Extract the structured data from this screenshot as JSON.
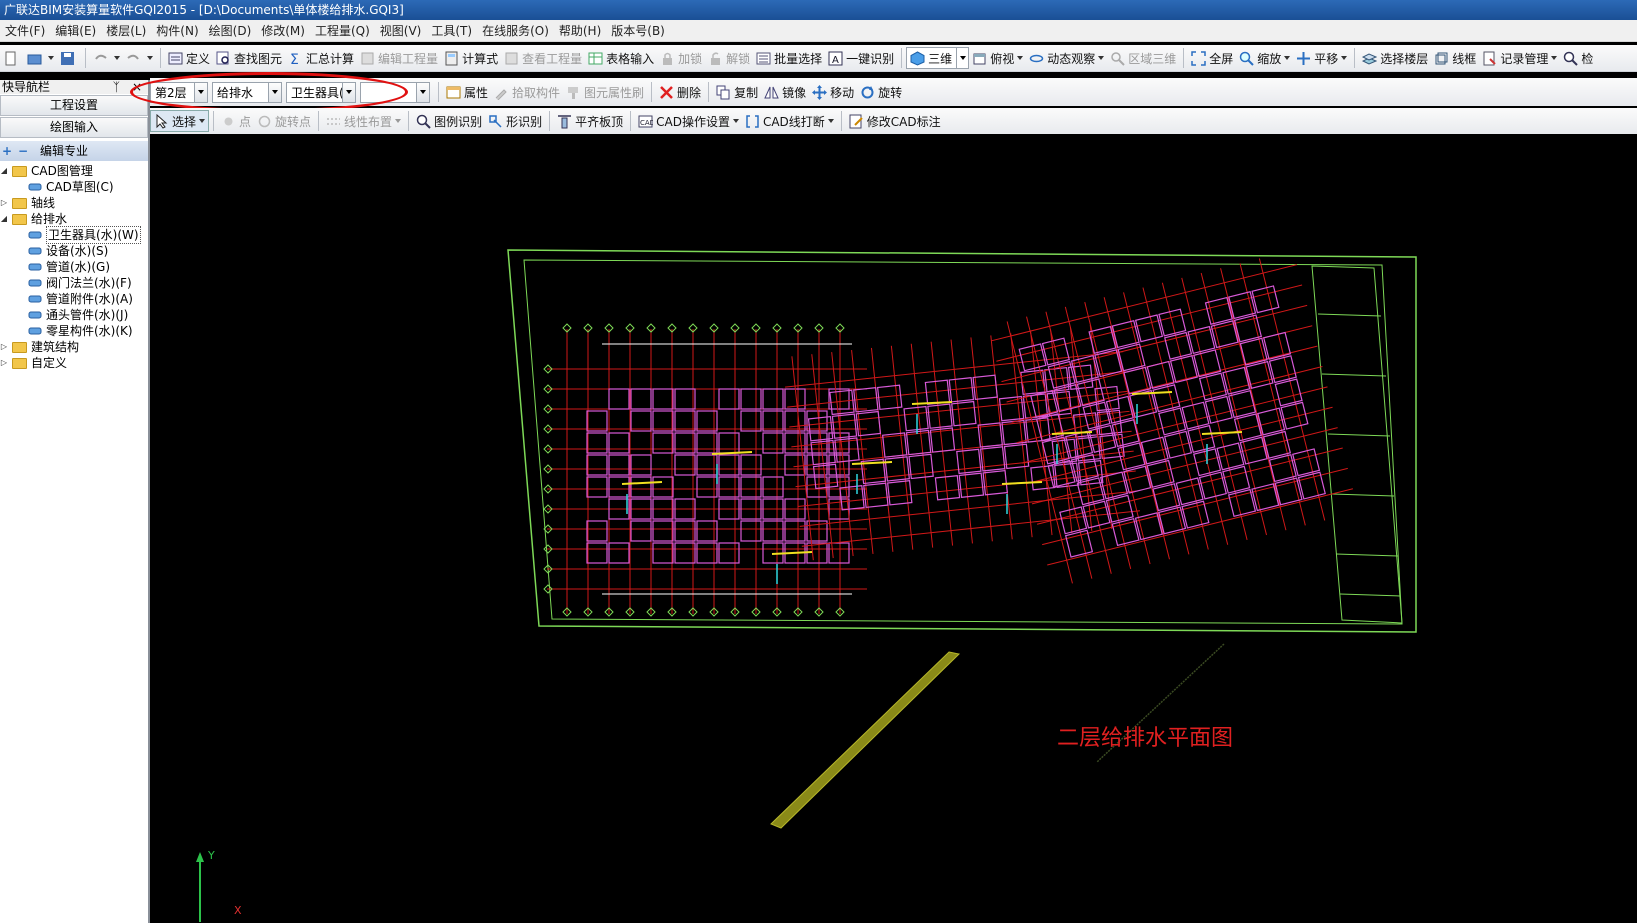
{
  "window": {
    "title": "广联达BIM安装算量软件GQI2015 - [D:\\Documents\\单体楼给排水.GQI3]"
  },
  "menu": [
    "文件(F)",
    "编辑(E)",
    "楼层(L)",
    "构件(N)",
    "绘图(D)",
    "修改(M)",
    "工程量(Q)",
    "视图(V)",
    "工具(T)",
    "在线服务(O)",
    "帮助(H)",
    "版本号(B)"
  ],
  "toolbar1": {
    "define": "定义",
    "find_element": "查找图元",
    "sum_calc": "汇总计算",
    "edit_quantity": "编辑工程量",
    "formula": "计算式",
    "view_quantity": "查看工程量",
    "table_input": "表格输入",
    "lock": "加锁",
    "unlock": "解锁",
    "batch_select": "批量选择",
    "one_click": "一键识别",
    "view3d": "三维",
    "top_view": "俯视",
    "dynamic_observe": "动态观察",
    "area_3d": "区域三维",
    "fullscreen": "全屏",
    "zoom": "缩放",
    "pan": "平移",
    "select_floor": "选择楼层",
    "wireframe": "线框",
    "record_mgmt": "记录管理",
    "check": "检"
  },
  "toolbar2": {
    "floor": "第2层",
    "discipline": "给排水",
    "component_type": "卫生器具(",
    "component": "",
    "properties": "属性",
    "pick_component": "拾取构件",
    "element_brush": "图元属性刷",
    "delete": "删除",
    "copy": "复制",
    "mirror": "镜像",
    "move": "移动",
    "rotate": "旋转"
  },
  "toolbar3": {
    "select": "选择",
    "point": "点",
    "rotate_point": "旋转点",
    "linear_layout": "线性布置",
    "legend_recognize": "图例识别",
    "shape_recognize": "形识别",
    "flush_top": "平齐板顶",
    "cad_settings": "CAD操作设置",
    "cad_break": "CAD线打断",
    "modify_cad_label": "修改CAD标注"
  },
  "leftpanel": {
    "header": "快导航栏",
    "pin": "ᛉ",
    "close": "×",
    "btn_project_settings": "工程设置",
    "btn_drawing_input": "绘图输入",
    "section_title": "编辑专业",
    "tree": [
      {
        "label": "CAD图管理",
        "level": 0,
        "type": "folder",
        "expanded": true
      },
      {
        "label": "CAD草图(C)",
        "level": 1,
        "type": "leaf"
      },
      {
        "label": "轴线",
        "level": 0,
        "type": "folder",
        "expanded": false
      },
      {
        "label": "给排水",
        "level": 0,
        "type": "folder",
        "expanded": true
      },
      {
        "label": "卫生器具(水)(W)",
        "level": 1,
        "type": "leaf"
      },
      {
        "label": "设备(水)(S)",
        "level": 1,
        "type": "leaf"
      },
      {
        "label": "管道(水)(G)",
        "level": 1,
        "type": "leaf"
      },
      {
        "label": "阀门法兰(水)(F)",
        "level": 1,
        "type": "leaf"
      },
      {
        "label": "管道附件(水)(A)",
        "level": 1,
        "type": "leaf"
      },
      {
        "label": "通头管件(水)(J)",
        "level": 1,
        "type": "leaf"
      },
      {
        "label": "零星构件(水)(K)",
        "level": 1,
        "type": "leaf"
      },
      {
        "label": "建筑结构",
        "level": 0,
        "type": "folder",
        "expanded": false
      },
      {
        "label": "自定义",
        "level": 0,
        "type": "folder",
        "expanded": false
      }
    ]
  },
  "canvas": {
    "plan_title": "二层给排水平面图",
    "axis_y": "Y",
    "axis_x": "X"
  },
  "colors": {
    "annotation_ellipse": "#e01010",
    "plan_title": "#e02020",
    "grid_red": "#d01818",
    "border_green": "#7ed957",
    "wall_magenta": "#d85ad8"
  }
}
